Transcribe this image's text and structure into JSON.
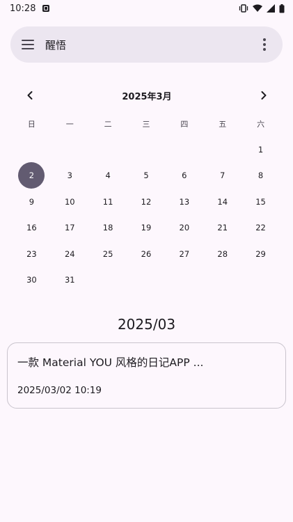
{
  "status_bar": {
    "time": "10:28",
    "icons": [
      "notification-icon",
      "vibrate-icon",
      "wifi-icon",
      "signal-icon",
      "battery-icon"
    ]
  },
  "search_bar": {
    "title": "醒悟",
    "left_icon": "menu-icon",
    "right_icon": "more-vert-icon"
  },
  "calendar": {
    "month_label": "2025年3月",
    "prev_icon": "chevron-left-icon",
    "next_icon": "chevron-right-icon",
    "weekdays": [
      "日",
      "一",
      "二",
      "三",
      "四",
      "五",
      "六"
    ],
    "leading_blanks": 6,
    "days": [
      "1",
      "2",
      "3",
      "4",
      "5",
      "6",
      "7",
      "8",
      "9",
      "10",
      "11",
      "12",
      "13",
      "14",
      "15",
      "16",
      "17",
      "18",
      "19",
      "20",
      "21",
      "22",
      "23",
      "24",
      "25",
      "26",
      "27",
      "28",
      "29",
      "30",
      "31"
    ],
    "selected_day": "2"
  },
  "month_title": "2025/03",
  "entries": [
    {
      "text": "一款 Material YOU 风格的日记APP ...",
      "timestamp": "2025/03/02 10:19"
    }
  ],
  "colors": {
    "background": "#fdf7fd",
    "search_bar": "#ece6f0",
    "selected_day": "#625b71",
    "card_border": "#c9c4cd"
  }
}
